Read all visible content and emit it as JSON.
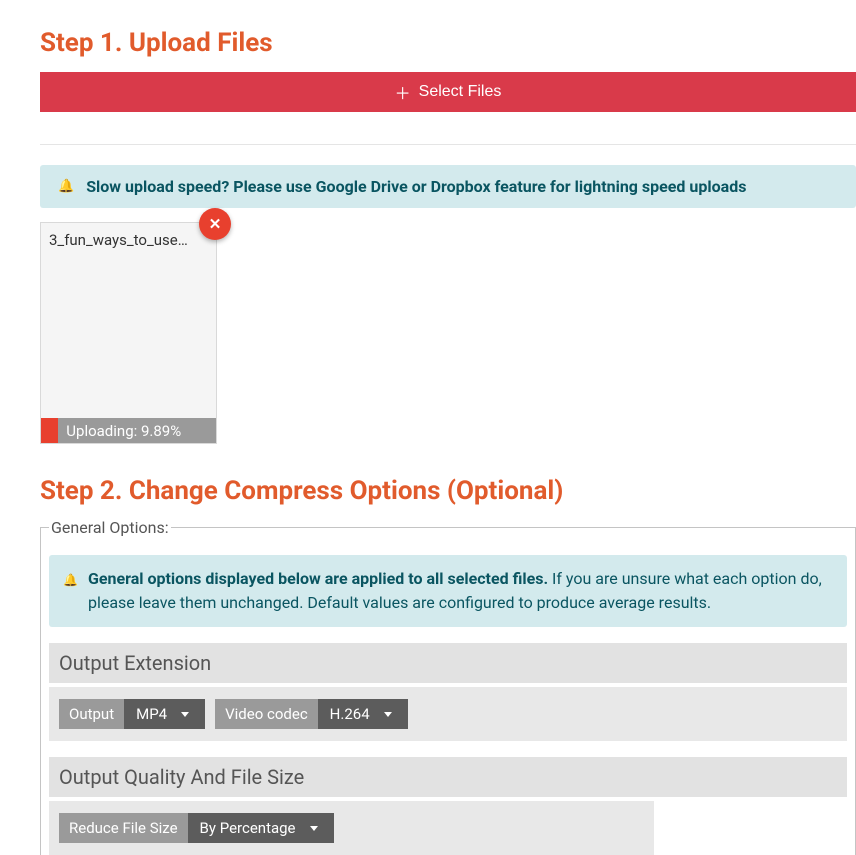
{
  "step1": {
    "title": "Step 1. Upload Files",
    "select_button": "Select Files"
  },
  "notice_upload": "Slow upload speed? Please use Google Drive or Dropbox feature for lightning speed uploads",
  "file": {
    "name": "3_fun_ways_to_use…",
    "progress_label": "Uploading: 9.89%",
    "progress_pct": 9.89
  },
  "step2": {
    "title": "Step 2. Change Compress Options (Optional)"
  },
  "general": {
    "legend": "General Options:",
    "notice_bold": "General options displayed below are applied to all selected files.",
    "notice_rest": " If you are unsure what each option do, please leave them unchanged. Default values are configured to produce average results."
  },
  "sections": {
    "output_extension": {
      "title": "Output Extension",
      "output_label": "Output",
      "output_value": "MP4",
      "codec_label": "Video codec",
      "codec_value": "H.264"
    },
    "quality": {
      "title": "Output Quality And File Size",
      "reduce_label": "Reduce File Size",
      "reduce_value": "By Percentage"
    }
  }
}
